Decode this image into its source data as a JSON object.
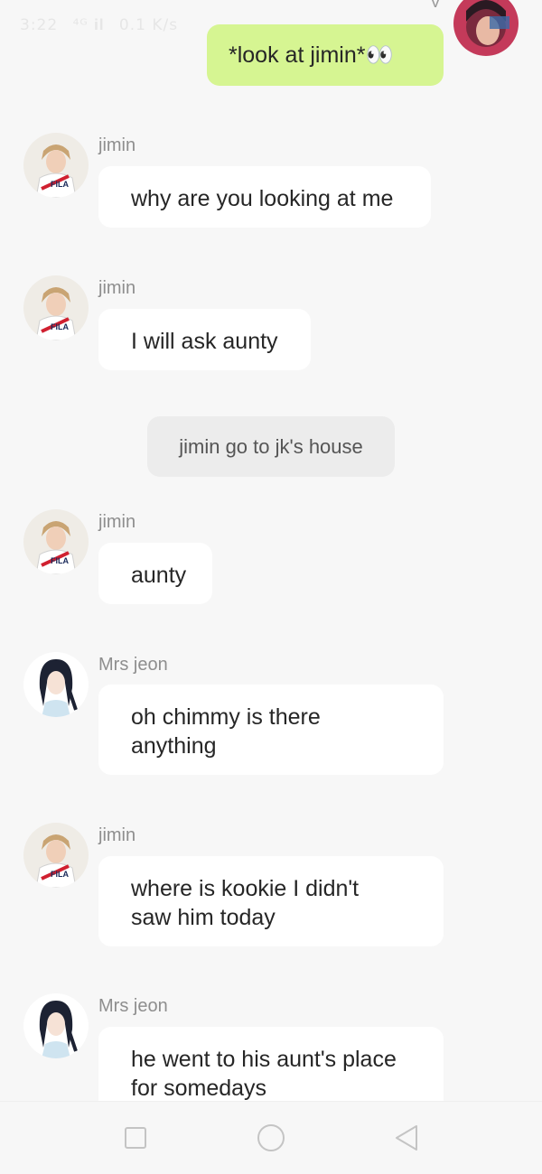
{
  "status_bar": {
    "time": "3:22",
    "signal": "⁴ᴳ 𝐢𝐥",
    "network": "0.1 K/s"
  },
  "stamp": "V",
  "messages": [
    {
      "sender": "",
      "text": "*look at jimin*👀",
      "type": "sent"
    },
    {
      "sender": "jimin",
      "text": "why are you looking at me",
      "type": "received",
      "avatar": "jimin-avatar"
    },
    {
      "sender": "jimin",
      "text": "I will ask aunty",
      "type": "received",
      "avatar": "jimin-avatar"
    },
    {
      "sender": "",
      "text": "jimin go to jk's house",
      "type": "narration"
    },
    {
      "sender": "jimin",
      "text": "aunty",
      "type": "received",
      "avatar": "jimin-avatar"
    },
    {
      "sender": "Mrs jeon",
      "text": "oh chimmy is there anything",
      "type": "received",
      "avatar": "mrs-jeon-avatar"
    },
    {
      "sender": "jimin",
      "text": "where is kookie I didn't saw him today",
      "type": "received",
      "avatar": "jimin-avatar"
    },
    {
      "sender": "Mrs jeon",
      "text": "he went to his aunt's place for somedays",
      "type": "received",
      "avatar": "mrs-jeon-avatar"
    }
  ],
  "colors": {
    "background": "#f7f7f7",
    "sent_bubble": "#d6f592",
    "received_bubble": "#ffffff",
    "narration_bubble": "#ececec"
  },
  "nav_icons": [
    "square-icon",
    "circle-home-icon",
    "triangle-back-icon"
  ]
}
